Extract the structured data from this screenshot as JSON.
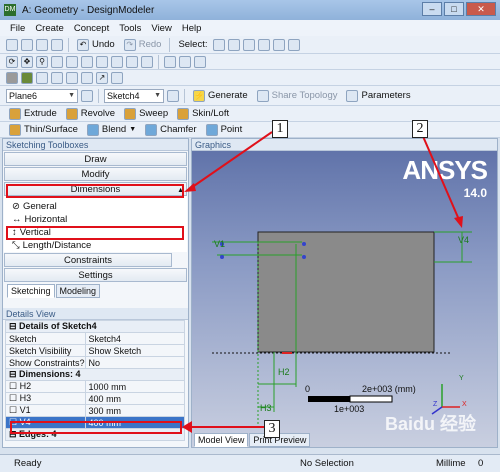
{
  "window": {
    "title": "A: Geometry - DesignModeler",
    "app_icon": "DM",
    "buttons": {
      "minimize": "–",
      "maximize": "□",
      "close": "✕"
    }
  },
  "menu": [
    "File",
    "Create",
    "Concept",
    "Tools",
    "View",
    "Help"
  ],
  "toolbar1": {
    "undo": "Undo",
    "redo": "Redo",
    "select_label": "Select:"
  },
  "toolbar3": {
    "plane": "Plane6",
    "sketch": "Sketch4",
    "generate": "Generate",
    "share_topology": "Share Topology",
    "parameters": "Parameters"
  },
  "toolbar4": {
    "extrude": "Extrude",
    "revolve": "Revolve",
    "sweep": "Sweep",
    "skin_loft": "Skin/Loft"
  },
  "toolbar5": {
    "thin_surface": "Thin/Surface",
    "blend": "Blend",
    "chamfer": "Chamfer",
    "point": "Point"
  },
  "sketching": {
    "title": "Sketching Toolboxes",
    "boxes": [
      "Draw",
      "Modify",
      "Dimensions"
    ],
    "dimension_tools": [
      "General",
      "Horizontal",
      "Vertical",
      "Length/Distance"
    ],
    "lower_boxes": [
      "Constraints",
      "Settings"
    ],
    "tabs": [
      "Sketching",
      "Modeling"
    ]
  },
  "details": {
    "title": "Details View",
    "group1": "Details of Sketch4",
    "rows": [
      [
        "Sketch",
        "Sketch4"
      ],
      [
        "Sketch Visibility",
        "Show Sketch"
      ],
      [
        "Show Constraints?",
        "No"
      ]
    ],
    "group2": "Dimensions: 4",
    "dims": [
      [
        "H2",
        "1000 mm"
      ],
      [
        "H3",
        "400 mm"
      ],
      [
        "V1",
        "300 mm"
      ],
      [
        "V4",
        "400 mm"
      ]
    ],
    "group3": "Edges: 4"
  },
  "graphics": {
    "title": "Graphics",
    "logo": "ANSYS",
    "version": "14.0",
    "labels": {
      "v4": "V4",
      "v1": "V1",
      "h2": "H2",
      "h3": "H3"
    },
    "scale": {
      "zero": "0",
      "max": "2e+003 (mm)",
      "mid": "1e+003"
    },
    "triad": {
      "x": "X",
      "y": "Y",
      "z": "Z"
    },
    "tabs": [
      "Model View",
      "Print Preview"
    ]
  },
  "callouts": [
    "1",
    "2",
    "3"
  ],
  "status": {
    "ready": "Ready",
    "selection": "No Selection",
    "units": "Millime",
    "deg": "0"
  },
  "watermark": "Baidu 经验"
}
